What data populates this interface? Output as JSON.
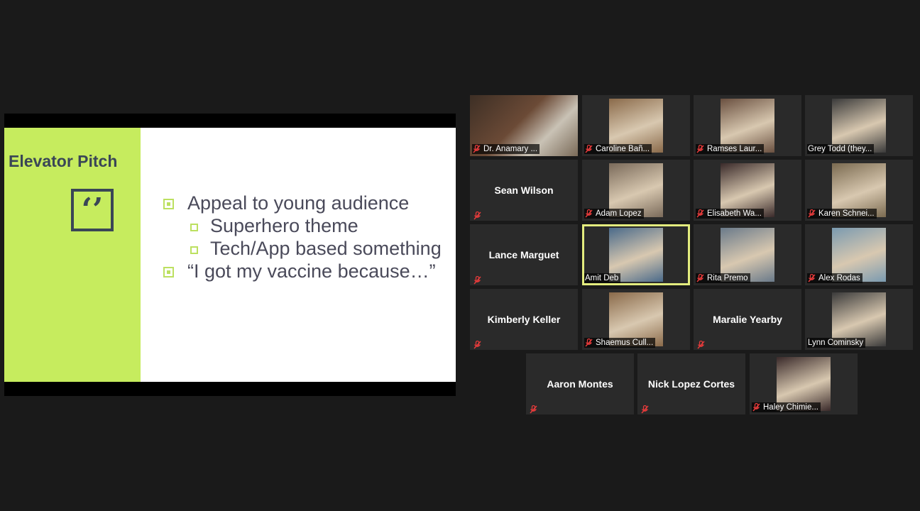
{
  "slide": {
    "title": "Elevator Pitch",
    "quote_glyph": "‘’",
    "bullets": [
      {
        "level": 1,
        "text": "Appeal to young audience"
      },
      {
        "level": 2,
        "text": "Superhero theme"
      },
      {
        "level": 2,
        "text": "Tech/App based something"
      },
      {
        "level": 1,
        "text": "“I got my vaccine because…”"
      }
    ]
  },
  "gallery": {
    "active_border_color": "#e3ec7e",
    "muted_icon": "mic-muted-icon",
    "participants": [
      {
        "name": "Dr. Anamary ...",
        "display": "video",
        "muted": true
      },
      {
        "name": "Caroline Bañ...",
        "display": "photo",
        "muted": true
      },
      {
        "name": "Ramses Laur...",
        "display": "photo",
        "muted": true
      },
      {
        "name": "Grey Todd (they...",
        "display": "photo",
        "muted": false
      },
      {
        "name": "Sean Wilson",
        "display": "name",
        "muted": true
      },
      {
        "name": "Adam Lopez",
        "display": "photo",
        "muted": true
      },
      {
        "name": "Elisabeth Wa...",
        "display": "photo",
        "muted": true
      },
      {
        "name": "Karen Schnei...",
        "display": "photo",
        "muted": true
      },
      {
        "name": "Lance Marguet",
        "display": "name",
        "muted": true
      },
      {
        "name": "Amit Deb",
        "display": "photo",
        "muted": false,
        "active": true
      },
      {
        "name": "Rita Premo",
        "display": "photo",
        "muted": true
      },
      {
        "name": "Alex Rodas",
        "display": "photo",
        "muted": true
      },
      {
        "name": "Kimberly Keller",
        "display": "name",
        "muted": true
      },
      {
        "name": "Shaemus Cull...",
        "display": "photo",
        "muted": true
      },
      {
        "name": "Maralie Yearby",
        "display": "name",
        "muted": true
      },
      {
        "name": "Lynn Cominsky",
        "display": "photo",
        "muted": false
      },
      {
        "name": "Aaron Montes",
        "display": "name",
        "muted": true
      },
      {
        "name": "Nick Lopez Cortes",
        "display": "name",
        "muted": true
      },
      {
        "name": "Haley Chimie...",
        "display": "photo",
        "muted": true
      }
    ]
  }
}
